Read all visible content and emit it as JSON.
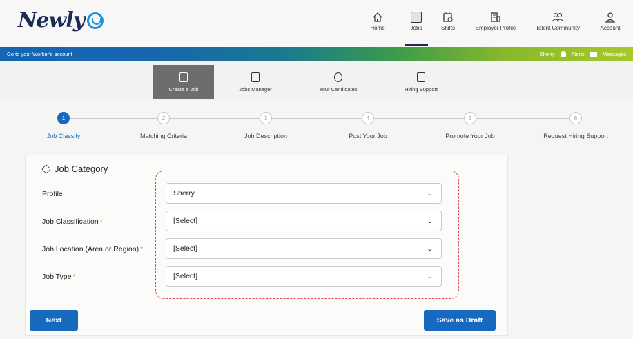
{
  "brand": {
    "name": "Newly",
    "logo_icon": "heart-circle-icon",
    "color": "#1b2b55"
  },
  "nav": [
    {
      "label": "Home",
      "icon": "home-icon",
      "active": false
    },
    {
      "label": "Jobs",
      "icon": "jobs-icon",
      "active": true
    },
    {
      "label": "Shifts",
      "icon": "calendar-icon",
      "active": false
    },
    {
      "label": "Employer Profile",
      "icon": "building-icon",
      "active": false
    },
    {
      "label": "Talent Community",
      "icon": "people-icon",
      "active": false
    },
    {
      "label": "Account",
      "icon": "user-icon",
      "active": false
    }
  ],
  "banner": {
    "link": "Go to your Worker's account",
    "user": "Sherry",
    "alerts": "Alerts",
    "messages": "Messages"
  },
  "subtabs": [
    {
      "label": "Create a Job",
      "icon": "create-job-icon",
      "active": true
    },
    {
      "label": "Jobs Manager",
      "icon": "clipboard-icon",
      "active": false
    },
    {
      "label": "Your Candidates",
      "icon": "candidates-icon",
      "active": false
    },
    {
      "label": "Hiring Support",
      "icon": "support-icon",
      "active": false
    }
  ],
  "steps": [
    {
      "num": "1",
      "label": "Job Classify",
      "active": true
    },
    {
      "num": "2",
      "label": "Matching Criteria",
      "active": false
    },
    {
      "num": "3",
      "label": "Job Description",
      "active": false
    },
    {
      "num": "4",
      "label": "Post Your Job",
      "active": false
    },
    {
      "num": "5",
      "label": "Promote Your Job",
      "active": false
    },
    {
      "num": "6",
      "label": "Request Hiring Support",
      "active": false
    }
  ],
  "form": {
    "title": "Job Category",
    "fields": [
      {
        "label": "Profile",
        "required": false,
        "value": "Sherry"
      },
      {
        "label": "Job Classification",
        "required": true,
        "value": "[Select]"
      },
      {
        "label": "Job Location (Area or Region)",
        "required": true,
        "value": "[Select]"
      },
      {
        "label": "Job Type",
        "required": true,
        "value": "[Select]"
      }
    ],
    "required_mark": "*"
  },
  "buttons": {
    "next": "Next",
    "save_draft": "Save as Draft"
  },
  "colors": {
    "primary": "#1769bf",
    "highlight": "#e8404a",
    "required": "#f08a24"
  }
}
